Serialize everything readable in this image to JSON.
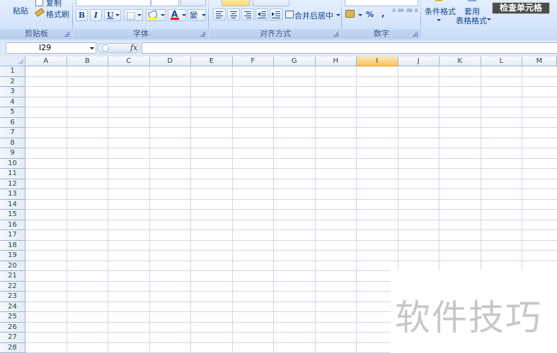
{
  "ribbon": {
    "clipboard": {
      "paste": "粘贴",
      "copy": "复制",
      "format_painter": "格式刷",
      "label": "剪贴板"
    },
    "font": {
      "bold": "B",
      "italic": "I",
      "underline": "U",
      "font_color_glyph": "A",
      "phonetic_glyph": "變",
      "label": "字体"
    },
    "alignment": {
      "merge_center": "合并后居中",
      "label": "对齐方式"
    },
    "number": {
      "percent": "%",
      "comma": ",",
      "inc_decimal": ".0 .00",
      "dec_decimal": ".00 .0",
      "label": "数字"
    },
    "styles": {
      "conditional_format": "条件格式",
      "table_format_line1": "套用",
      "table_format_line2": "表格格式",
      "check_cell": "检查单元格"
    }
  },
  "formula_bar": {
    "name_box": "I29",
    "fx": "fx",
    "value": ""
  },
  "grid": {
    "columns": [
      "A",
      "B",
      "C",
      "D",
      "E",
      "F",
      "G",
      "H",
      "I",
      "J",
      "K",
      "L",
      "M"
    ],
    "selected_column": "I",
    "rows": [
      "1",
      "2",
      "3",
      "4",
      "5",
      "6",
      "7",
      "8",
      "9",
      "10",
      "11",
      "12",
      "13",
      "14",
      "15",
      "16",
      "17",
      "18",
      "19",
      "20",
      "21",
      "22",
      "23",
      "24",
      "25",
      "26",
      "27",
      "28"
    ]
  },
  "watermark": "软件技巧",
  "colors": {
    "ribbon_bg": "#d7e6fb",
    "header_bg": "#e4ecf7",
    "selected_header": "#f8c45e",
    "grid_line": "#d0d7e5",
    "watermark": "#c7c7c7"
  },
  "icons": [
    "paste-icon",
    "copy-icon",
    "format-painter-icon",
    "border-icon",
    "fill-color-icon",
    "font-color-icon",
    "align-left-icon",
    "align-center-icon",
    "align-right-icon",
    "decrease-indent-icon",
    "increase-indent-icon",
    "merge-center-icon",
    "accounting-format-icon",
    "fx-icon"
  ]
}
